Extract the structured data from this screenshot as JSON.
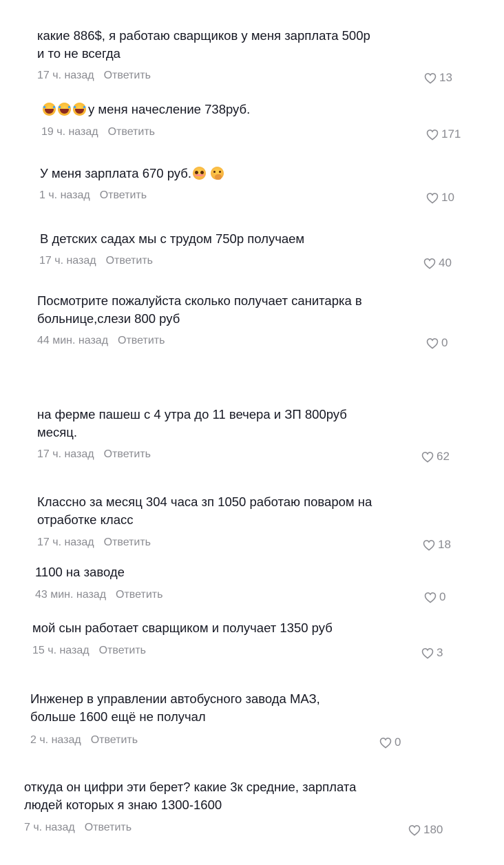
{
  "comments": [
    {
      "text": "какие 886$, я работаю сварщиков у меня зарплата 500р\nи то не всегда",
      "time": "17 ч. назад",
      "reply": "Ответить",
      "likes": "13"
    },
    {
      "text": "у меня начесление 738руб.",
      "emoji": [
        "laughing-face",
        "laughing-face",
        "laughing-face"
      ],
      "time": "19 ч. назад",
      "reply": "Ответить",
      "likes": "171"
    },
    {
      "text": "У меня зарплата 670 руб.",
      "emoji": [
        "pleading-face",
        "hand-over-mouth-face"
      ],
      "time": "1 ч. назад",
      "reply": "Ответить",
      "likes": "10"
    },
    {
      "text": "В детских садах мы с трудом 750р получаем",
      "time": "17 ч. назад",
      "reply": "Ответить",
      "likes": "40"
    },
    {
      "text": "Посмотрите пожалуйста сколько получает санитарка в\nбольнице,слези 800 руб",
      "time": "44 мин. назад",
      "reply": "Ответить",
      "likes": "0"
    },
    {
      "text": "на ферме пашеш с 4 утра до 11 вечера и ЗП 800руб\nмесяц.",
      "time": "17 ч. назад",
      "reply": "Ответить",
      "likes": "62"
    },
    {
      "text": "Классно за месяц 304 часа зп 1050 работаю поваром на\nотработке класс",
      "time": "17 ч. назад",
      "reply": "Ответить",
      "likes": "18"
    },
    {
      "text": "1100 на заводе",
      "time": "43 мин. назад",
      "reply": "Ответить",
      "likes": "0"
    },
    {
      "text": "мой сын работает сварщиком и получает 1350 руб",
      "time": "15 ч. назад",
      "reply": "Ответить",
      "likes": "3"
    },
    {
      "text": "Инженер в управлении автобусного завода МАЗ,\nбольше 1600 ещё не получал",
      "time": "2 ч. назад",
      "reply": "Ответить",
      "likes": "0"
    },
    {
      "text": "откуда он цифри эти берет? какие 3к средние, зарплата\nлюдей которых я знаю 1300-1600",
      "time": "7 ч. назад",
      "reply": "Ответить",
      "likes": "180"
    }
  ],
  "icons": {
    "like": "heart-outline-icon"
  },
  "colors": {
    "text": "#161823",
    "meta": "#8a8b91",
    "background": "#ffffff"
  }
}
